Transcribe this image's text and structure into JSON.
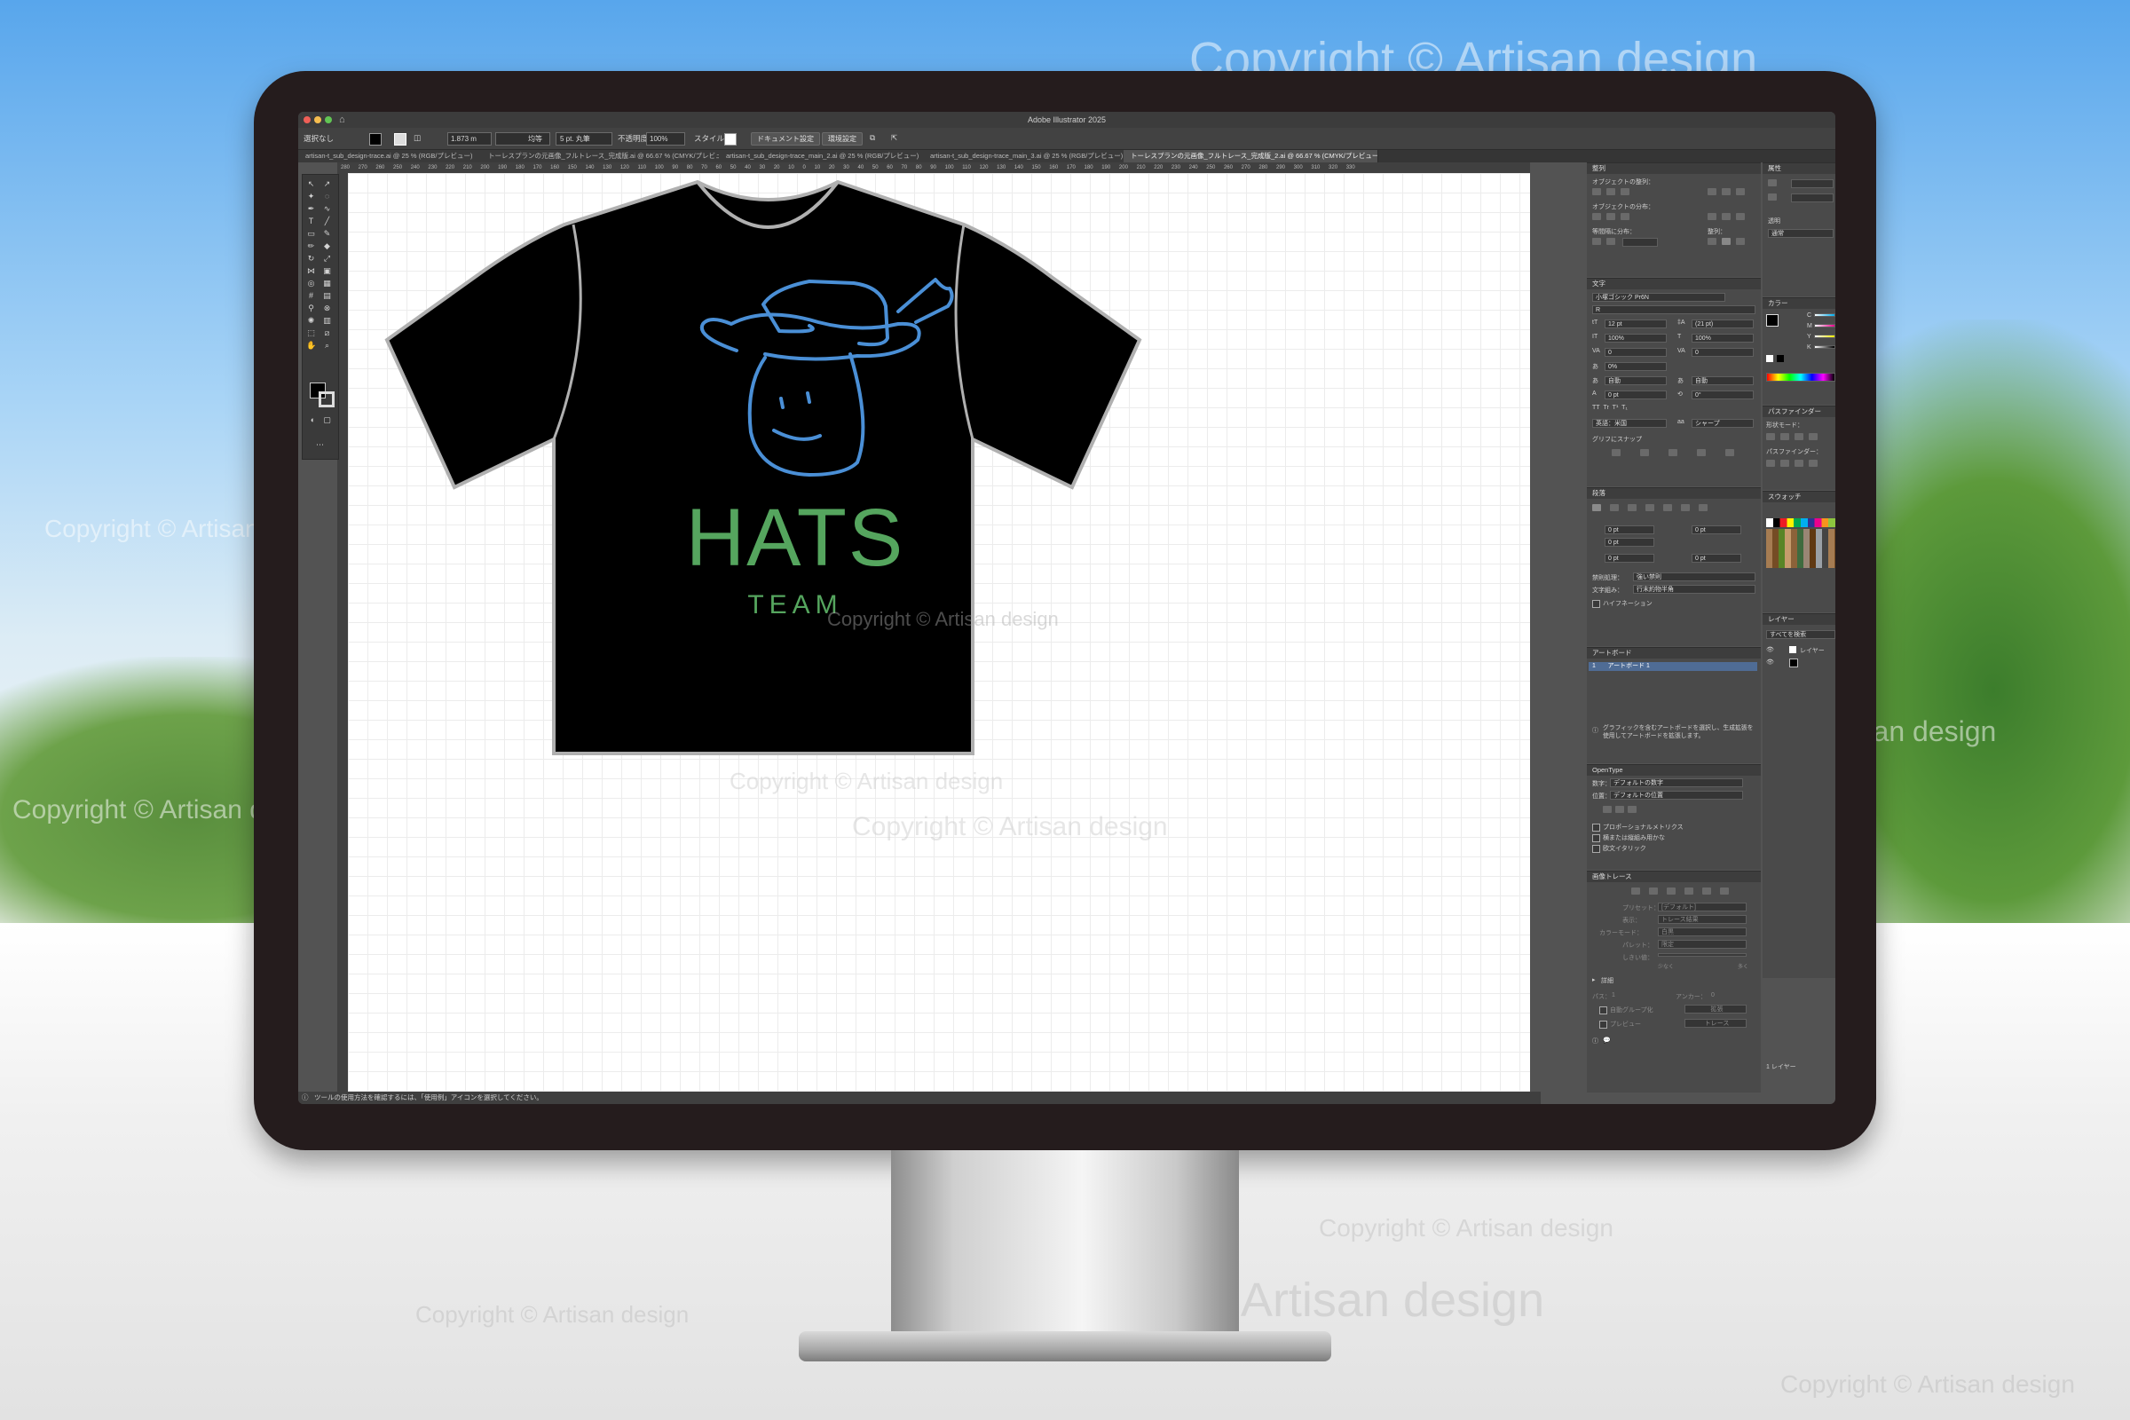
{
  "watermark": "Copyright © Artisan design",
  "window": {
    "title": "Adobe Illustrator 2025",
    "controls": {
      "selection": "選択なし",
      "stroke_weight": "1.873 m",
      "stroke_profile": "均等",
      "brush": "5 pt. 丸筆",
      "opacity_label": "不透明度",
      "opacity_value": "100%",
      "style_label": "スタイル",
      "doc_settings": "ドキュメント設定",
      "preferences": "環境設定"
    },
    "tabs": [
      "artisan-t_sub_design-trace.ai @ 25 % (RGB/プレビュー)",
      "トーレスプランの元画像_フルトレース_完成版.ai @ 66.67 % (CMYK/プレビュー)",
      "artisan-t_sub_design-trace_main_2.ai @ 25 % (RGB/プレビュー)",
      "artisan-t_sub_design-trace_main_3.ai @ 25 % (RGB/プレビュー)",
      "トーレスプランの元画像_フルトレース_完成版_2.ai @ 66.67 % (CMYK/プレビュー)"
    ],
    "ruler_marks": "280 270 260 250 240 230 220 210 200 190 180 170 160 150 140 130 120 110 100 90 80 70 60 50 40 30 20 10 0 10 20 30 40 50 60 70 80 90 100 110 120 130 140 150 160 170 180 190 200 210 220 230 240 250 260 270 280 290 300 310 320 330",
    "status": "ツールの使用方法を確認するには、「使用例」アイコンを選択してください。"
  },
  "artwork": {
    "title": "HATS",
    "subtitle": "TEAM",
    "colors": {
      "shirt": "#000000",
      "outline": "#b0b0b0",
      "hat": "#4a8fd6",
      "text": "#55a55e"
    }
  },
  "panels": {
    "align": {
      "title": "整列",
      "objects": "オブジェクトの整列：",
      "distribute": "オブジェクトの分布：",
      "spacing": "等間隔に分布：",
      "align_to": "整列："
    },
    "character": {
      "title": "文字",
      "font": "小塚ゴシック Pr6N",
      "style": "R",
      "size": "12 pt",
      "leading": "(21 pt)",
      "hscale": "100%",
      "vscale": "100%",
      "tracking": "0",
      "kerning": "0",
      "tsume": "0%",
      "auto": "自動",
      "auto2": "自動",
      "baseline": "0 pt",
      "rotate": "0°",
      "language": "英語：米国",
      "aa": "シャープ",
      "snap": "グリフにスナップ"
    },
    "paragraph": {
      "title": "段落",
      "indent_left": "0 pt",
      "indent_right": "0 pt",
      "first_line": "0 pt",
      "space_before": "0 pt",
      "space_after": "0 pt",
      "kinsoku_label": "禁則処理：",
      "kinsoku": "強い禁則",
      "mojikumi_label": "文字組み：",
      "mojikumi": "行末約物半角",
      "hyphenation": "ハイフネーション"
    },
    "artboards": {
      "title": "アートボード",
      "num": "1",
      "item": "アートボード 1",
      "info": "グラフィックを含むアートボードを選択し、生成拡張を使用してアートボードを拡張します。"
    },
    "opentype": {
      "title": "OpenType",
      "figure_label": "数字：",
      "figure": "デフォルトの数字",
      "position_label": "位置：",
      "position": "デフォルトの位置",
      "proportional": "プロポーショナルメトリクス",
      "kana": "横または縦組み用かな",
      "roman_italic": "欧文イタリック"
    },
    "trace": {
      "title": "画像トレース",
      "preset_label": "プリセット：",
      "preset": "[デフォルト]",
      "view_label": "表示：",
      "view": "トレース結果",
      "mode_label": "カラーモード：",
      "mode": "白黒",
      "palette_label": "パレット：",
      "palette": "限定",
      "threshold_label": "しきい値：",
      "less": "少なく",
      "more": "多く",
      "advanced": "詳細",
      "paths": "パス：",
      "paths_value": "1",
      "anchors": "アンカー：",
      "anchors_value": "0",
      "preview": "プレビュー",
      "auto_group": "自動グループ化",
      "expand": "拡張",
      "trace_btn": "トレース"
    },
    "properties": {
      "title": "属性",
      "blend": "通常",
      "opacity": "透明",
      "opacity_value": "100%"
    },
    "color": {
      "title": "カラー",
      "c": "C",
      "m": "M",
      "y": "Y",
      "k": "K"
    },
    "pathfinder": {
      "title": "パスファインダー",
      "shape_mode": "形状モード：",
      "pathfinders": "パスファインダー："
    },
    "swatches": {
      "title": "スウォッチ"
    },
    "layers": {
      "title": "レイヤー",
      "search": "すべてを検索",
      "layer1": "レイヤー",
      "footer": "1 レイヤー"
    }
  }
}
